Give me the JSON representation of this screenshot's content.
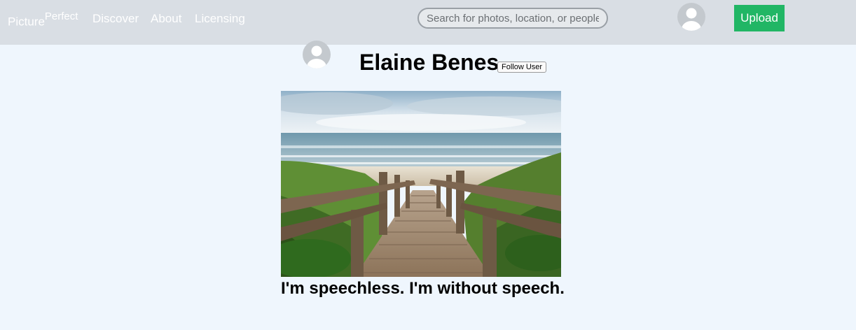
{
  "navbar": {
    "brand_main": "Picture",
    "brand_super": "Perfect",
    "links": [
      "Discover",
      "About",
      "Licensing"
    ],
    "search_placeholder": "Search for photos, location, or people",
    "upload_label": "Upload"
  },
  "profile": {
    "name": "Elaine Benes",
    "follow_label": "Follow User"
  },
  "post": {
    "caption": "I'm speechless. I'm without speech."
  },
  "colors": {
    "navbar_bg": "#d9dee4",
    "page_bg": "#eff6fd",
    "upload_bg": "#21b665",
    "avatar_bg": "#c4c9ce"
  }
}
